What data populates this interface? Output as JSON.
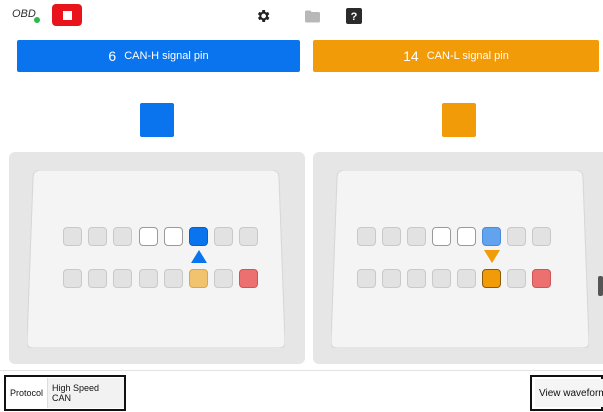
{
  "topbar": {
    "obd_label": "OBD",
    "icons": [
      "stop-icon",
      "settings-gear-icon",
      "folder-icon",
      "help-icon"
    ]
  },
  "left_signal": {
    "pin": "6",
    "label": "CAN-H signal pin",
    "color": "#0a74ee"
  },
  "right_signal": {
    "pin": "14",
    "label": "CAN-L signal pin",
    "color": "#f29b09"
  },
  "connector_pins": {
    "top_row": [
      "gray",
      "gray",
      "gray",
      "white",
      "white",
      "blue",
      "gray",
      "gray"
    ],
    "bottom_row": [
      "gray",
      "gray",
      "gray",
      "gray",
      "gray",
      "orange",
      "gray",
      "red"
    ]
  },
  "colors": {
    "blue": "#0a74ee",
    "blue_light": "#62a3ef",
    "orange": "#f29b09",
    "orange_light": "#f2c36e",
    "red": "#ec7070",
    "stop_red": "#e8131b"
  },
  "bottom": {
    "protocol_label": "Protocol",
    "protocol_value": "High Speed CAN",
    "view_waveform": "View waveform"
  }
}
